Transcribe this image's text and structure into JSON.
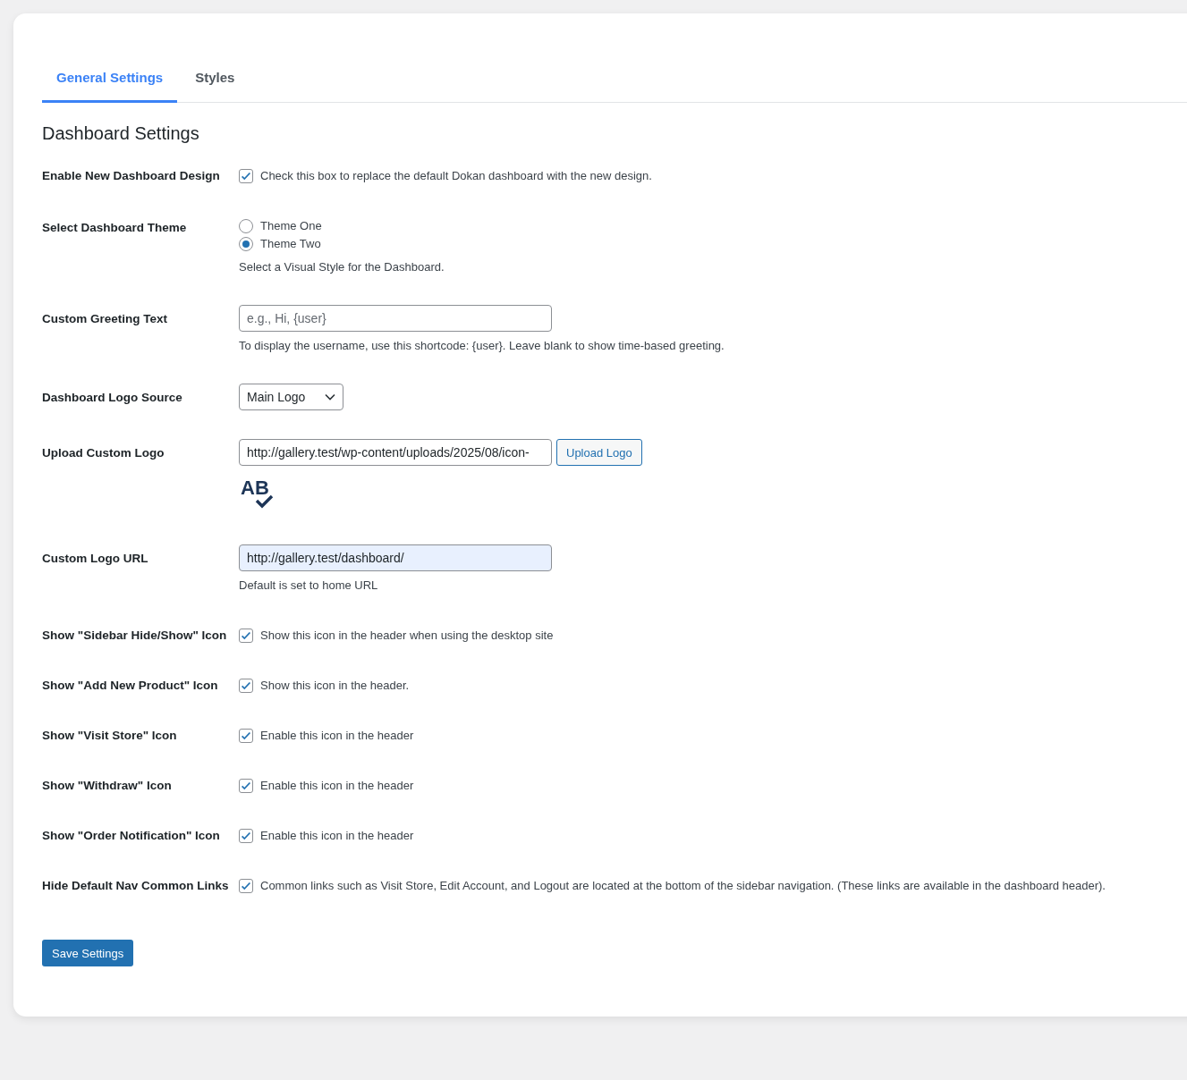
{
  "tabs": [
    {
      "label": "General Settings",
      "selected": true
    },
    {
      "label": "Styles",
      "selected": false
    }
  ],
  "section_title": "Dashboard Settings",
  "rows": [
    {
      "kind": "checkbox",
      "label": "Enable New Dashboard Design",
      "checked": true,
      "text": "Check this box to replace the default Dokan dashboard with the new design."
    },
    {
      "kind": "radio",
      "label": "Select Dashboard Theme",
      "options": [
        {
          "label": "Theme One",
          "selected": false
        },
        {
          "label": "Theme Two",
          "selected": true
        }
      ],
      "description": "Select a Visual Style for the Dashboard."
    },
    {
      "kind": "text",
      "label": "Custom Greeting Text",
      "placeholder": "e.g., Hi, {user}",
      "description": "To display the username, use this shortcode: {user}. Leave blank to show time-based greeting."
    },
    {
      "kind": "select",
      "label": "Dashboard Logo Source",
      "value": "Main Logo"
    },
    {
      "kind": "upload",
      "label": "Upload Custom Logo",
      "value": "http://gallery.test/wp-content/uploads/2025/08/icon-",
      "button": "Upload Logo",
      "logo_text": "AB"
    },
    {
      "kind": "url",
      "label": "Custom Logo URL",
      "value": "http://gallery.test/dashboard/",
      "description": "Default is set to home URL"
    },
    {
      "kind": "checkbox",
      "label": "Show \"Sidebar Hide/Show\" Icon",
      "checked": true,
      "text": "Show this icon in the header when using the desktop site"
    },
    {
      "kind": "checkbox",
      "label": "Show \"Add New Product\" Icon",
      "checked": true,
      "text": "Show this icon in the header."
    },
    {
      "kind": "checkbox",
      "label": "Show \"Visit Store\" Icon",
      "checked": true,
      "text": "Enable this icon in the header"
    },
    {
      "kind": "checkbox",
      "label": "Show \"Withdraw\" Icon",
      "checked": true,
      "text": "Enable this icon in the header"
    },
    {
      "kind": "checkbox",
      "label": "Show \"Order Notification\" Icon",
      "checked": true,
      "text": "Enable this icon in the header"
    },
    {
      "kind": "checkbox",
      "label": "Hide Default Nav Common Links",
      "checked": true,
      "text": "Common links such as Visit Store, Edit Account, and Logout are located at the bottom of the sidebar navigation. (These links are available in the dashboard header)."
    }
  ],
  "save_button": "Save Settings"
}
